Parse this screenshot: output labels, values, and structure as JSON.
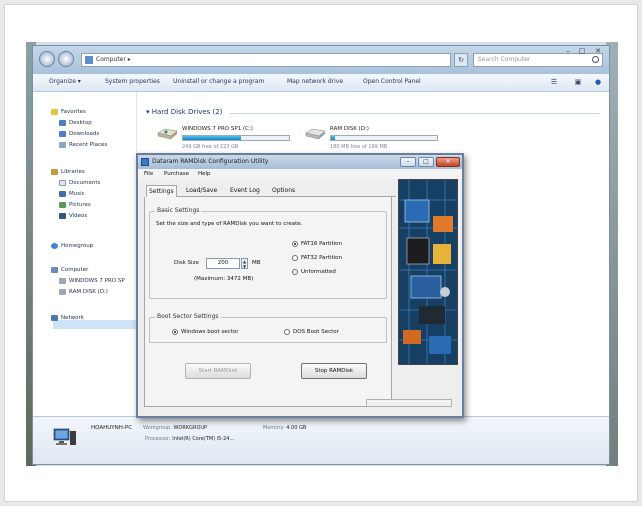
{
  "explorer": {
    "address_path": "Computer ▸",
    "search_placeholder": "Search Computer",
    "toolbar": {
      "organize": "Organize ▾",
      "system_properties": "System properties",
      "uninstall": "Uninstall or change a program",
      "map_drive": "Map network drive",
      "control_panel": "Open Control Panel"
    },
    "nav": {
      "favorites": "Favorites",
      "desktop": "Desktop",
      "downloads": "Downloads",
      "recent": "Recent Places",
      "libraries": "Libraries",
      "documents": "Documents",
      "music": "Music",
      "pictures": "Pictures",
      "videos": "Videos",
      "homegroup": "Homegroup",
      "computer": "Computer",
      "drive_c": "WINDOWS 7 PRO SP",
      "drive_d": "RAM DISK (D:)",
      "network": "Network"
    },
    "section_title": "Hard Disk Drives (2)",
    "drives": [
      {
        "label": "WINDOWS 7 PRO SP1 (C:)",
        "free": "249 GB free of 223 GB",
        "used_fraction": 0.55
      },
      {
        "label": "RAM DISK (D:)",
        "free": "180 MB free of 199 MB",
        "used_fraction": 0.04
      }
    ],
    "details": {
      "name": "HOAHUYNH-PC",
      "workgroup_key": "Workgroup:",
      "workgroup": "WORKGROUP",
      "memory_key": "Memory:",
      "memory": "4.00 GB",
      "processor_key": "Processor:",
      "processor": "Intel(R) Core(TM) i5-24..."
    }
  },
  "dialog": {
    "title": "Dataram RAMDisk Configuration Utility",
    "menu": [
      "File",
      "Purchase",
      "Help"
    ],
    "tabs": [
      "Settings",
      "Load/Save",
      "Event Log",
      "Options"
    ],
    "basic": {
      "title": "Basic Settings",
      "description": "Set the size and type of RAMDisk you want to create.",
      "disk_size_label": "Disk Size",
      "disk_size_value": "200",
      "unit": "MB",
      "maximum": "(Maximum:  3472 MB)",
      "partitions": [
        "FAT16 Partition",
        "FAT32 Partition",
        "Unformatted"
      ]
    },
    "boot": {
      "title": "Boot Sector Settings",
      "windows": "Windows boot sector",
      "dos": "DOS Boot Sector"
    },
    "start_button": "Start RAMDisk",
    "stop_button": "Stop RAMDisk"
  }
}
